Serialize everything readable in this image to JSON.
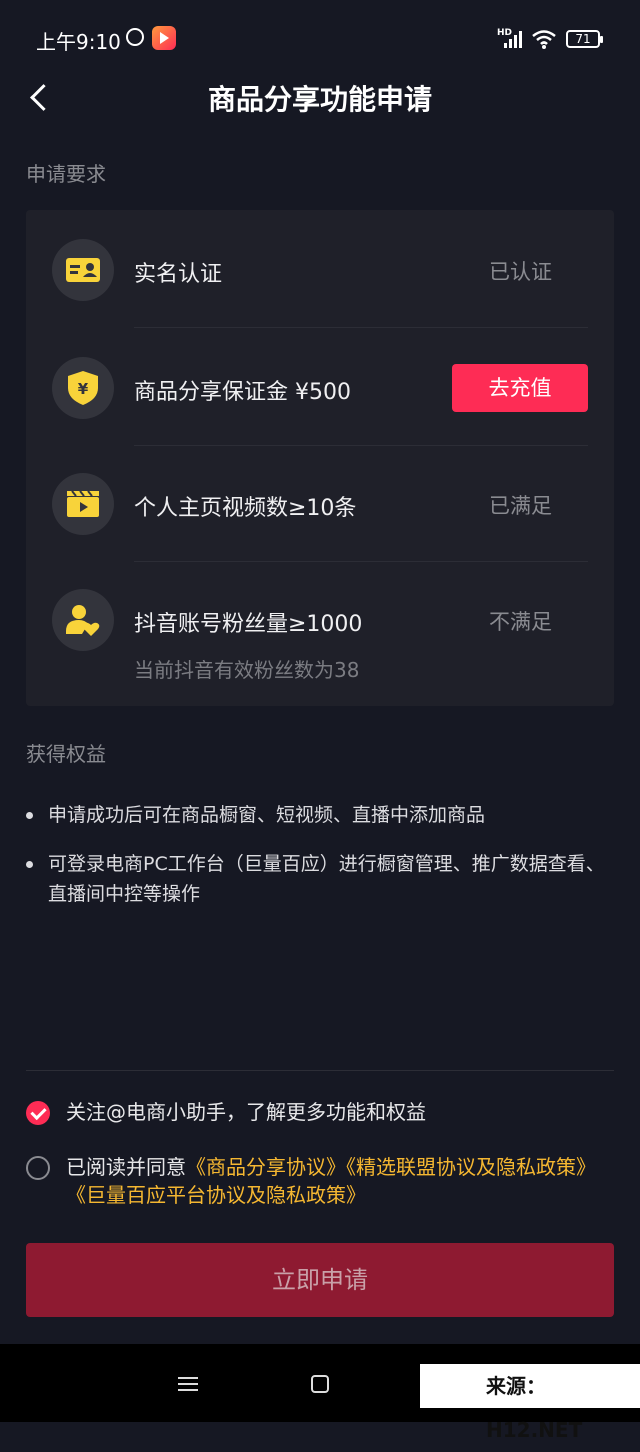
{
  "status_bar": {
    "time": "上午9:10",
    "network": "HD",
    "battery": "71"
  },
  "header": {
    "title": "商品分享功能申请"
  },
  "requirements": {
    "section_title": "申请要求",
    "items": [
      {
        "icon": "id-card-icon",
        "label": "实名认证",
        "status": "已认证"
      },
      {
        "icon": "yen-shield-icon",
        "label": "商品分享保证金 ¥500",
        "action": "去充值"
      },
      {
        "icon": "video-clapper-icon",
        "label": "个人主页视频数≥10条",
        "status": "已满足"
      },
      {
        "icon": "fans-icon",
        "label": "抖音账号粉丝量≥1000",
        "status": "不满足",
        "sub": "当前抖音有效粉丝数为38"
      }
    ]
  },
  "benefits": {
    "section_title": "获得权益",
    "items": [
      "申请成功后可在商品橱窗、短视频、直播中添加商品",
      "可登录电商PC工作台（巨量百应）进行橱窗管理、推广数据查看、直播间中控等操作"
    ]
  },
  "agreements": {
    "follow": {
      "checked": true,
      "text": "关注@电商小助手，了解更多功能和权益"
    },
    "terms": {
      "checked": false,
      "prefix": "已阅读并同意",
      "link1": "《商品分享协议》",
      "link2": "《精选联盟协议及隐私政策》",
      "link3": "《巨量百应平台协议及隐私政策》"
    }
  },
  "apply_button": "立即申请",
  "watermark": "来源：H12.NET",
  "colors": {
    "background": "#161823",
    "card": "#1f2029",
    "accent": "#fe2c55",
    "link": "#f5b731",
    "icon_yellow": "#f8d33a"
  }
}
